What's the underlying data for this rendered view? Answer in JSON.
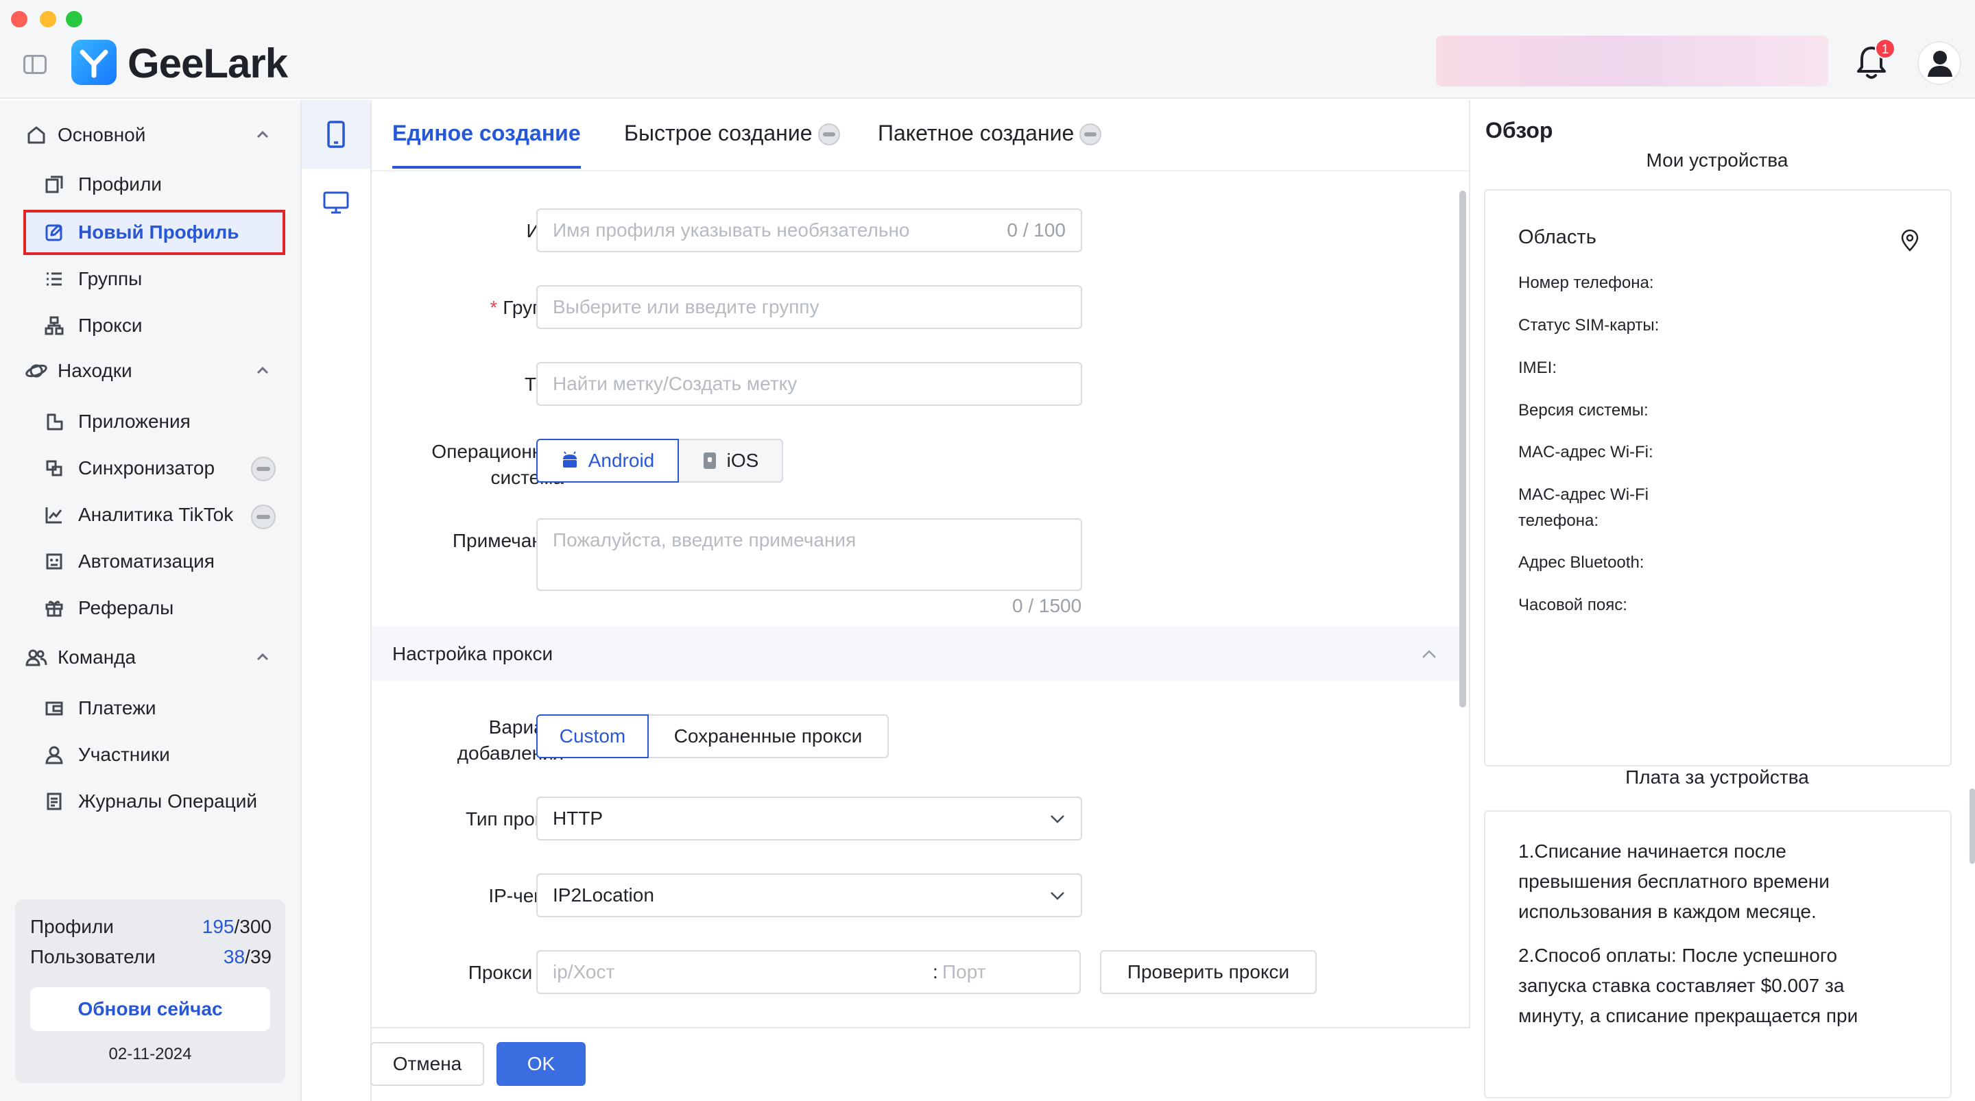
{
  "app": {
    "name": "GeeLark",
    "notifications_count": "1"
  },
  "sidebar": {
    "groups": [
      {
        "label": "Основной",
        "items": [
          {
            "label": "Профили"
          },
          {
            "label": "Новый Профиль"
          },
          {
            "label": "Группы"
          },
          {
            "label": "Прокси"
          }
        ]
      },
      {
        "label": "Находки",
        "items": [
          {
            "label": "Приложения"
          },
          {
            "label": "Синхронизатор"
          },
          {
            "label": "Аналитика TikTok"
          },
          {
            "label": "Автоматизация"
          },
          {
            "label": "Рефералы"
          }
        ]
      },
      {
        "label": "Команда",
        "items": [
          {
            "label": "Платежи"
          },
          {
            "label": "Участники"
          },
          {
            "label": "Журналы Операций"
          }
        ]
      }
    ],
    "usage": {
      "profiles_label": "Профили",
      "profiles_used": "195",
      "profiles_total": "/300",
      "users_label": "Пользователи",
      "users_used": "38",
      "users_total": "/39",
      "upgrade_label": "Обнови сейчас",
      "date": "02-11-2024"
    }
  },
  "tabs": [
    {
      "label": "Единое создание"
    },
    {
      "label": "Быстрое создание"
    },
    {
      "label": "Пакетное создание"
    }
  ],
  "form": {
    "name_label": "Имя",
    "name_placeholder": "Имя профиля указывать необязательно",
    "name_count": "0 / 100",
    "group_required": "*",
    "group_label": "Группа",
    "group_placeholder": "Выберите или введите группу",
    "tags_label": "Теги",
    "tags_placeholder": "Найти метку/Создать метку",
    "os_label_1": "Операционная",
    "os_label_2": "система",
    "os_android": "Android",
    "os_ios": "iOS",
    "note_label": "Примечание",
    "note_placeholder": "Пожалуйста, введите примечания",
    "note_count": "0 / 1500",
    "proxy_section": "Настройка прокси",
    "add_variant_label_1": "Вариант",
    "add_variant_label_2": "добавления",
    "variant_custom": "Custom",
    "variant_saved": "Сохраненные прокси",
    "proxy_type_label": "Тип прокси",
    "proxy_type_value": "HTTP",
    "ip_checker_label": "IP-чекер",
    "ip_checker_value": "IP2Location",
    "proxy_label": "Прокси",
    "proxy_host_placeholder": "ip/Хост",
    "proxy_port_sep": ":",
    "proxy_port_placeholder": "Порт",
    "check_proxy_label": "Проверить прокси"
  },
  "actions": {
    "cancel": "Отмена",
    "ok": "OK"
  },
  "overview": {
    "title": "Обзор",
    "subtitle": "Мои устройства",
    "area_label": "Область",
    "fields": [
      "Номер телефона:",
      "Статус SIM-карты:",
      "IMEI:",
      "Версия системы:",
      "MAC-адрес Wi-Fi:",
      "MAC-адрес Wi-Fi телефона:",
      "Адрес Bluetooth:",
      "Часовой пояс:"
    ],
    "fee_title": "Плата за устройства",
    "fee_para_1": "1.Списание начинается после превышения бесплатного времени использования в каждом месяце.",
    "fee_para_2": "2.Способ оплаты: После успешного запуска ставка составляет $0.007 за минуту, а списание прекращается при"
  },
  "colors": {
    "accent": "#2857d6",
    "primary_button": "#3a6ee0",
    "highlight_outline": "#e22525"
  }
}
